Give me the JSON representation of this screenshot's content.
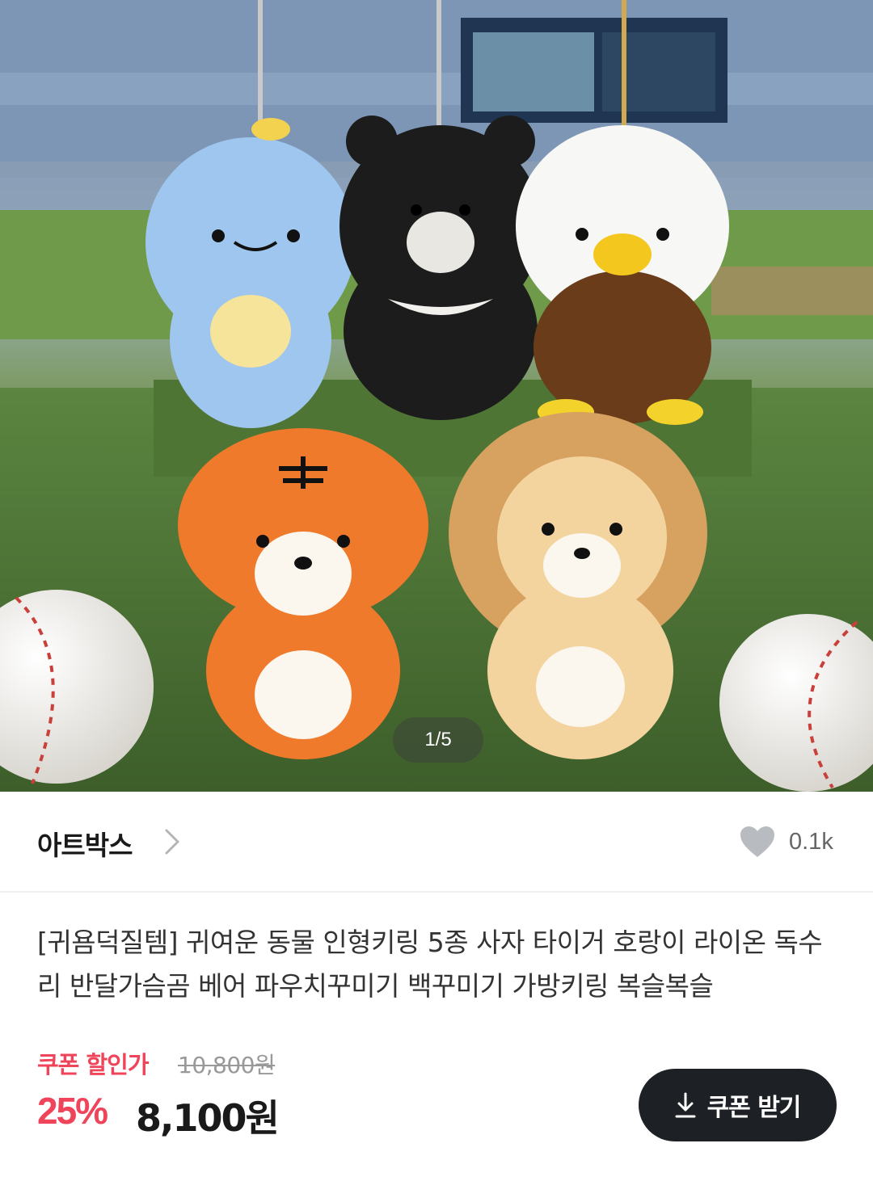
{
  "gallery": {
    "counter": "1/5"
  },
  "seller": {
    "name": "아트박스",
    "like_count": "0.1k"
  },
  "product": {
    "title": "[귀욤덕질템] 귀여운 동물 인형키링 5종 사자 타이거 호랑이 라이온 독수리 반달가슴곰 베어 파우치꾸미기 백꾸미기 가방키링 복슬복슬"
  },
  "price": {
    "coupon_label": "쿠폰 할인가",
    "original": "10,800원",
    "discount_rate": "25%",
    "sale": "8,100원"
  },
  "actions": {
    "coupon_button_label": "쿠폰 받기"
  },
  "colors": {
    "accent_red": "#f0445b",
    "button_dark": "#1d2024"
  },
  "icons": {
    "seller_link": "chevron-right-icon",
    "like": "heart-icon",
    "coupon": "download-icon"
  }
}
